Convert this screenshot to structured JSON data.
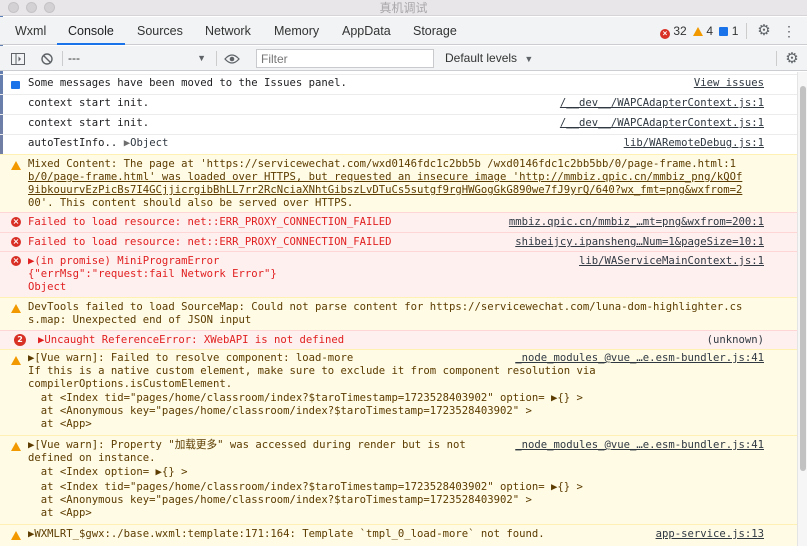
{
  "window": {
    "title": "真机调试"
  },
  "tabs": [
    {
      "label": "Wxml"
    },
    {
      "label": "Console"
    },
    {
      "label": "Sources"
    },
    {
      "label": "Network"
    },
    {
      "label": "Memory"
    },
    {
      "label": "AppData"
    },
    {
      "label": "Storage"
    }
  ],
  "counts": {
    "errors": "32",
    "warnings": "4",
    "info": "1"
  },
  "toolbar": {
    "context": "---",
    "filter_placeholder": "Filter",
    "levels": "Default levels"
  },
  "messages": [
    {
      "type": "info",
      "text": "Some messages have been moved to the Issues panel.",
      "source": "View issues"
    },
    {
      "type": "log",
      "text": "context start init.",
      "source": "/__dev__/WAPCAdapterContext.js:1"
    },
    {
      "type": "log",
      "text": "context start init.",
      "source": "/__dev__/WAPCAdapterContext.js:1"
    },
    {
      "type": "log",
      "text": "autoTestInfo..",
      "object": "Object",
      "source": "lib/WARemoteDebug.js:1"
    },
    {
      "type": "warn",
      "lines": [
        "Mixed Content: The page at 'https://servicewechat.com/wxd0146fdc1c2bb5b /wxd0146fdc1c2bb5bb/0/page-frame.html:1",
        "b/0/page-frame.html' was loaded over HTTPS, but requested an insecure image 'http://mmbiz.qpic.cn/mmbiz_png/kQOf",
        "9ibkouurvEzPicBs7I4GCjjicrgibBhLL7rr2RcNciaXNhtGibszLvDTuCs5sutgf9rgHWGogGkG890we7fJ9yrQ/640?wx_fmt=png&wxfrom=2",
        "00'. This content should also be served over HTTPS."
      ]
    },
    {
      "type": "error",
      "text": "Failed to load resource: net::ERR_PROXY_CONNECTION_FAILED",
      "source": "mmbiz.qpic.cn/mmbiz_…mt=png&wxfrom=200:1"
    },
    {
      "type": "error",
      "text": "Failed to load resource: net::ERR_PROXY_CONNECTION_FAILED",
      "source": "shibeijcy.ipansheng…Num=1&pageSize=10:1"
    },
    {
      "type": "error",
      "lines": [
        "▶(in promise) MiniProgramError",
        "{\"errMsg\":\"request:fail Network Error\"}",
        "Object"
      ],
      "source": "lib/WAServiceMainContext.js:1"
    },
    {
      "type": "warn",
      "lines": [
        "DevTools failed to load SourceMap: Could not parse content for https://servicewechat.com/luna-dom-highlighter.cs",
        "s.map: Unexpected end of JSON input"
      ]
    },
    {
      "type": "error",
      "badge": "2",
      "text": "▶Uncaught ReferenceError: XWebAPI is not defined",
      "source": "(unknown)"
    },
    {
      "type": "warn",
      "lines": [
        "▶[Vue warn]: Failed to resolve component: load-more",
        "If this is a native custom element, make sure to exclude it from component resolution via",
        "compilerOptions.isCustomElement.",
        "  at <Index tid=\"pages/home/classroom/index?$taroTimestamp=1723528403902\" option= ▶{} >",
        "  at <Anonymous key=\"pages/home/classroom/index?$taroTimestamp=1723528403902\" >",
        "  at <App>"
      ],
      "source": "_node_modules_@vue_…e.esm-bundler.js:41"
    },
    {
      "type": "warn",
      "lines": [
        "▶[Vue warn]: Property \"加载更多\" was accessed during render but is not",
        "defined on instance.",
        "  at <Index option= ▶{} >",
        "  at <Index tid=\"pages/home/classroom/index?$taroTimestamp=1723528403902\" option= ▶{} >",
        "  at <Anonymous key=\"pages/home/classroom/index?$taroTimestamp=1723528403902\" >",
        "  at <App>"
      ],
      "source": "_node_modules_@vue_…e.esm-bundler.js:41"
    },
    {
      "type": "warn",
      "text": "▶WXMLRT_$gwx:./base.wxml:template:171:164: Template `tmpl_0_load-more` not found.",
      "source": "app-service.js:13"
    }
  ],
  "icons": {
    "close": "close-icon",
    "settings": "gear-icon",
    "more": "more-vert-icon",
    "sidebar": "sidebar-toggle-icon",
    "clear": "clear-console-icon",
    "eye": "eye-icon"
  }
}
